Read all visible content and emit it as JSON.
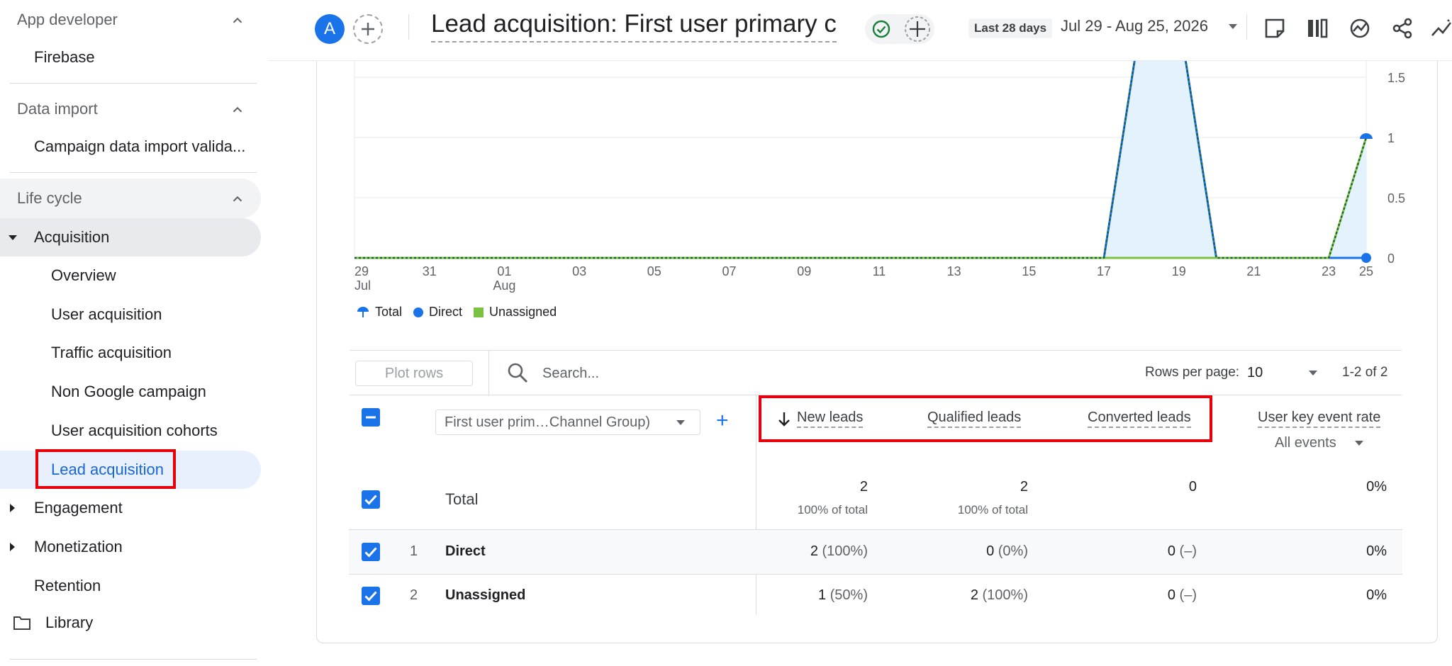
{
  "sidebar": {
    "sections": [
      {
        "label": "App developer"
      },
      {
        "label": "Data import"
      },
      {
        "label": "Life cycle"
      }
    ],
    "app_developer_items": [
      "Firebase"
    ],
    "data_import_items": [
      "Campaign data import valida..."
    ],
    "acquisition": "Acquisition",
    "acquisition_items": [
      "Overview",
      "User acquisition",
      "Traffic acquisition",
      "Non Google campaign",
      "User acquisition cohorts",
      "Lead acquisition"
    ],
    "engagement": "Engagement",
    "monetization": "Monetization",
    "retention": "Retention",
    "library": "Library"
  },
  "topbar": {
    "avatar_letter": "A",
    "title": "Lead acquisition: First user primary ch...",
    "date_label": "Last 28 days",
    "date_range": "Jul 29 - Aug 25, 2026"
  },
  "chart_data": {
    "type": "line",
    "x": [
      "29 Jul",
      "31",
      "01 Aug",
      "03",
      "05",
      "07",
      "09",
      "11",
      "13",
      "15",
      "17",
      "19",
      "21",
      "23",
      "25"
    ],
    "x_tick_labels": [
      {
        "top": "29",
        "bottom": "Jul"
      },
      {
        "top": "31",
        "bottom": ""
      },
      {
        "top": "01",
        "bottom": "Aug"
      },
      {
        "top": "03",
        "bottom": ""
      },
      {
        "top": "05",
        "bottom": ""
      },
      {
        "top": "07",
        "bottom": ""
      },
      {
        "top": "09",
        "bottom": ""
      },
      {
        "top": "11",
        "bottom": ""
      },
      {
        "top": "13",
        "bottom": ""
      },
      {
        "top": "15",
        "bottom": ""
      },
      {
        "top": "17",
        "bottom": ""
      },
      {
        "top": "19",
        "bottom": ""
      },
      {
        "top": "21",
        "bottom": ""
      },
      {
        "top": "23",
        "bottom": ""
      },
      {
        "top": "25",
        "bottom": ""
      }
    ],
    "y_ticks": [
      "0",
      "0.5",
      "1",
      "1.5"
    ],
    "ylim": [
      0,
      2
    ],
    "days": 28,
    "series": [
      {
        "name": "Total",
        "color": "#1a73e8",
        "fill": "#e3f2fd",
        "values": [
          0,
          0,
          0,
          0,
          0,
          0,
          0,
          0,
          0,
          0,
          0,
          0,
          0,
          0,
          0,
          0,
          0,
          0,
          0,
          0,
          0,
          2,
          2,
          0,
          0,
          0,
          0,
          1
        ]
      },
      {
        "name": "Direct",
        "color": "#1a73e8",
        "values": [
          0,
          0,
          0,
          0,
          0,
          0,
          0,
          0,
          0,
          0,
          0,
          0,
          0,
          0,
          0,
          0,
          0,
          0,
          0,
          0,
          0,
          2,
          2,
          0,
          0,
          0,
          0,
          0
        ]
      },
      {
        "name": "Unassigned",
        "color": "#7cc242",
        "values": [
          0,
          0,
          0,
          0,
          0,
          0,
          0,
          0,
          0,
          0,
          0,
          0,
          0,
          0,
          0,
          0,
          0,
          0,
          0,
          0,
          0,
          0,
          0,
          0,
          0,
          0,
          0,
          1
        ]
      }
    ],
    "legend": [
      "Total",
      "Direct",
      "Unassigned"
    ]
  },
  "table": {
    "plot_rows": "Plot rows",
    "search_placeholder": "Search...",
    "rows_per_page_label": "Rows per page:",
    "rows_per_page": "10",
    "pager": "1-2 of 2",
    "dimension": "First user prim…Channel Group)",
    "headers": {
      "new_leads": "New leads",
      "qualified_leads": "Qualified leads",
      "converted_leads": "Converted leads",
      "key_event_rate": "User key event rate",
      "all_events": "All events"
    },
    "total": {
      "label": "Total",
      "new_leads": "2",
      "new_leads_pct": "100% of total",
      "qualified_leads": "2",
      "qualified_leads_pct": "100% of total",
      "converted_leads": "0",
      "key_event_rate": "0%"
    },
    "rows": [
      {
        "index": "1",
        "label": "Direct",
        "new_leads": "2",
        "new_leads_pct": "(100%)",
        "qualified_leads": "0",
        "qualified_leads_pct": "(0%)",
        "converted_leads": "0",
        "converted_leads_pct": "(–)",
        "key_event_rate": "0%"
      },
      {
        "index": "2",
        "label": "Unassigned",
        "new_leads": "1",
        "new_leads_pct": "(50%)",
        "qualified_leads": "2",
        "qualified_leads_pct": "(100%)",
        "converted_leads": "0",
        "converted_leads_pct": "(–)",
        "key_event_rate": "0%"
      }
    ]
  }
}
